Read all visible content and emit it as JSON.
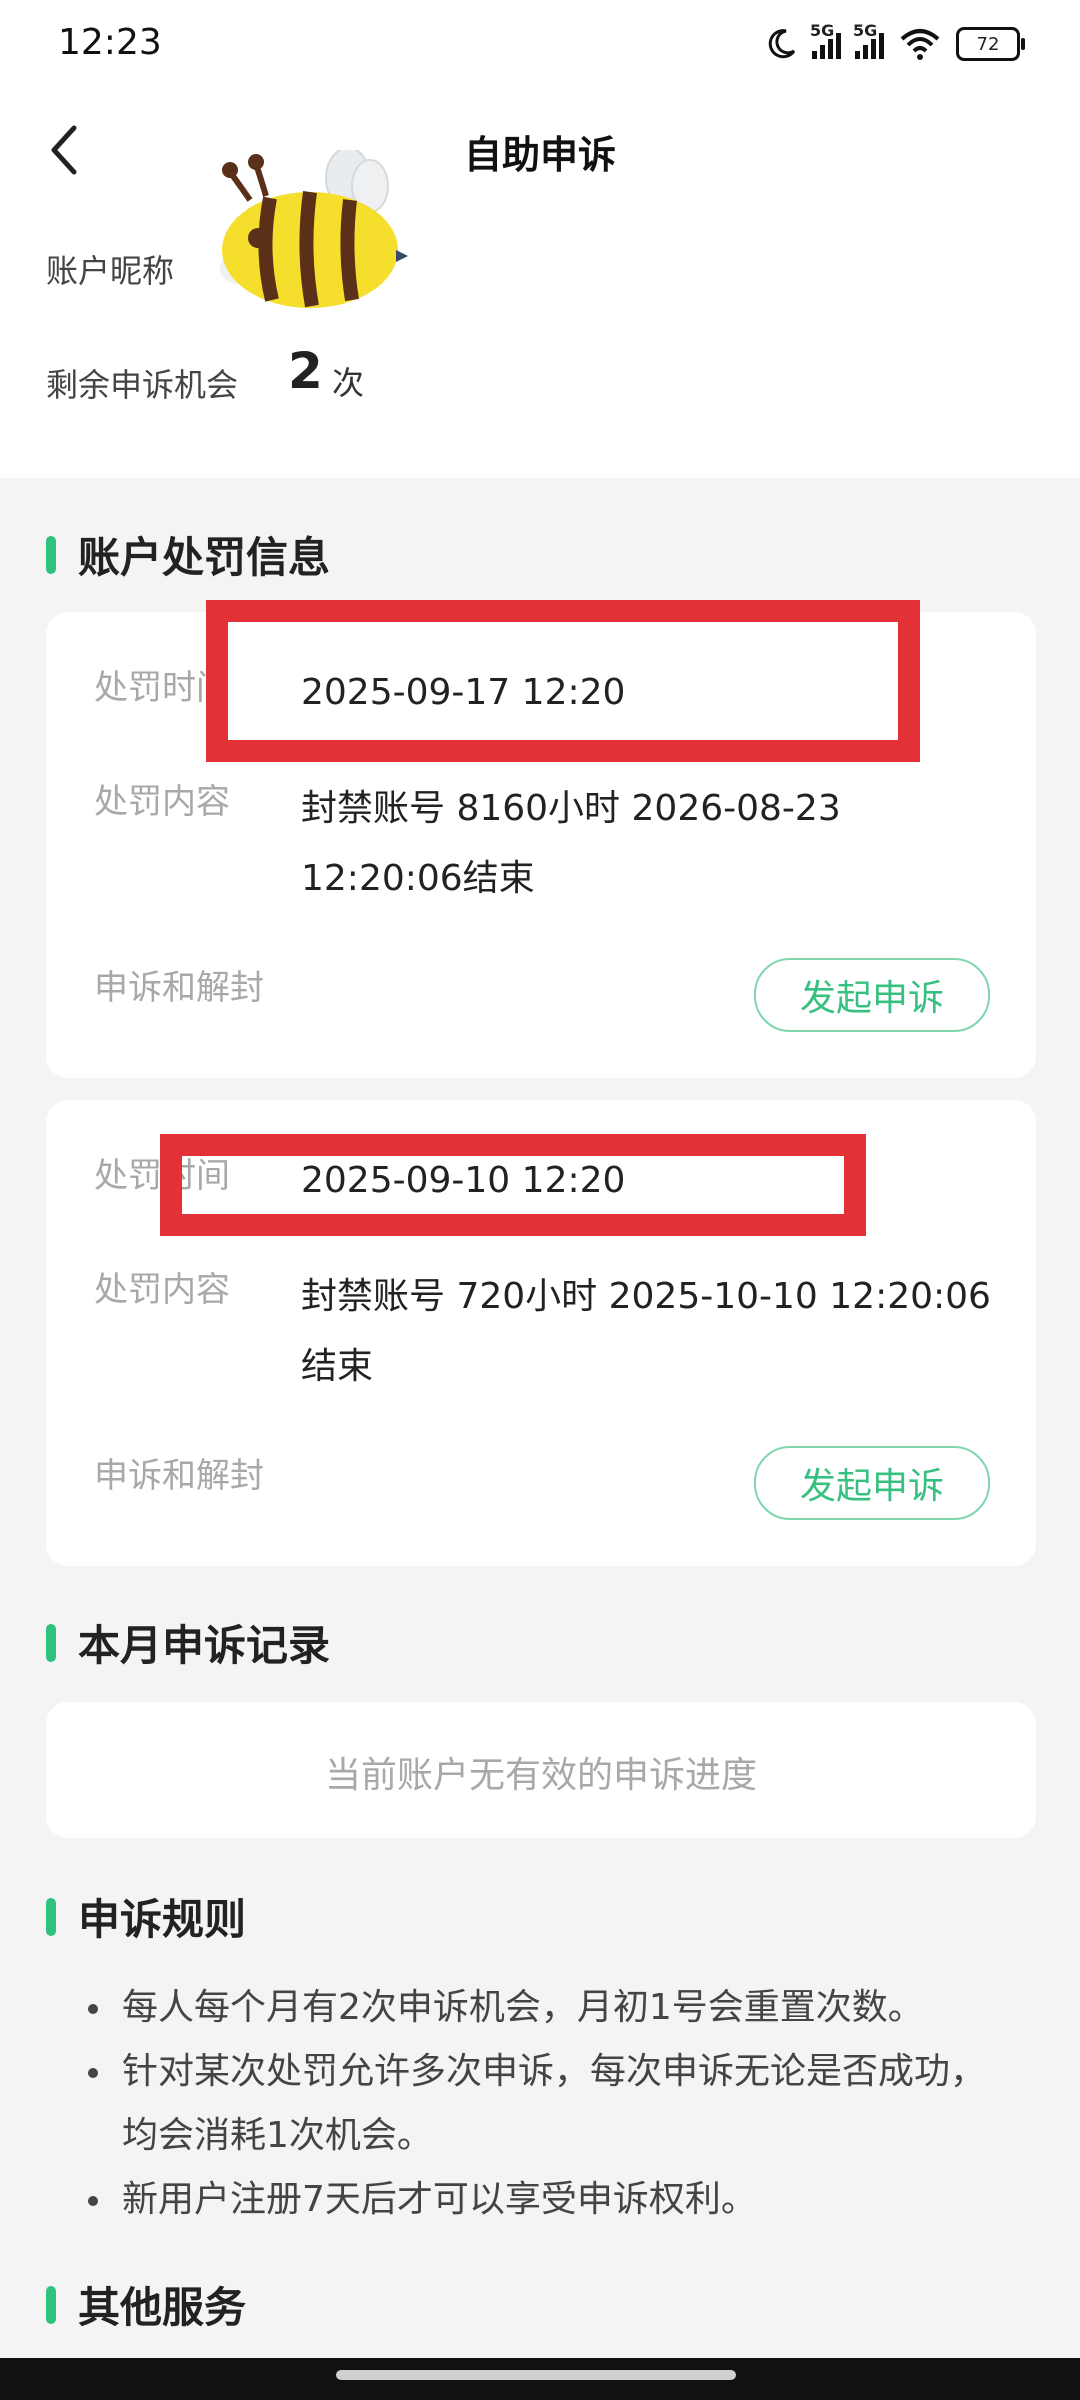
{
  "status_bar": {
    "time": "12:23",
    "signal1_label": "5G",
    "signal2_label": "5G",
    "battery": "72",
    "icons": [
      "moon-icon",
      "signal-icon",
      "signal-icon",
      "wifi-icon",
      "battery-icon"
    ]
  },
  "header": {
    "title": "自助申诉",
    "back_icon": "chevron-left-icon"
  },
  "account": {
    "nickname_label": "账户昵称",
    "avatar": "bee-avatar",
    "remaining_label": "剩余申诉机会",
    "remaining_count": "2",
    "remaining_unit": "次"
  },
  "penalty_section": {
    "title": "账户处罚信息",
    "records": [
      {
        "time_label": "处罚时间",
        "time_value": "2025-09-17 12:20",
        "content_label": "处罚内容",
        "content_value": "封禁账号 8160小时 2026-08-23 12:20:06结束",
        "appeal_label": "申诉和解封",
        "appeal_button": "发起申诉"
      },
      {
        "time_label": "处罚时间",
        "time_value": "2025-09-10 12:20",
        "content_value": "封禁账号 720小时 2025-10-10 12:20:06结束",
        "content_label": "处罚内容",
        "appeal_label": "申诉和解封",
        "appeal_button": "发起申诉"
      }
    ]
  },
  "monthly_section": {
    "title": "本月申诉记录",
    "empty_text": "当前账户无有效的申诉进度"
  },
  "rules_section": {
    "title": "申诉规则",
    "items": [
      "每人每个月有2次申诉机会，月初1号会重置次数。",
      "针对某次处罚允许多次申诉，每次申诉无论是否成功，均会消耗1次机会。",
      "新用户注册7天后才可以享受申诉权利。"
    ]
  },
  "other_section": {
    "title": "其他服务"
  },
  "colors": {
    "accent": "#2ec27e",
    "button_text": "#37c080",
    "highlight_box": "#e23237",
    "background": "#f4f4f4"
  }
}
